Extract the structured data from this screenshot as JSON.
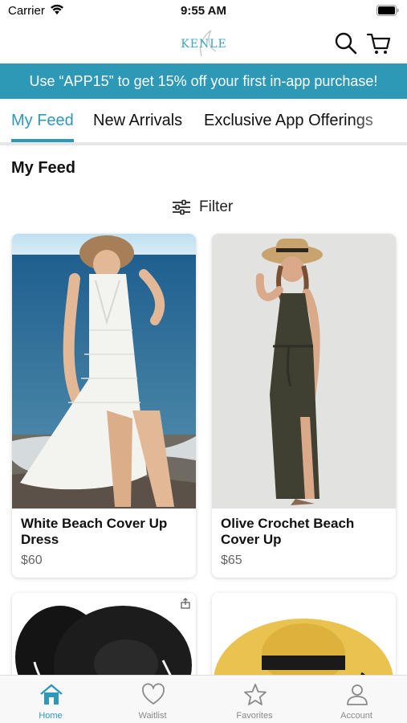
{
  "status_bar": {
    "carrier": "Carrier",
    "time": "9:55 AM"
  },
  "header": {
    "logo_text": "KENLE",
    "search_icon": "search-icon",
    "cart_icon": "cart-icon"
  },
  "promo": {
    "text": "Use “APP15” to get 15% off your first in-app purchase!"
  },
  "tabs": [
    {
      "label": "My Feed",
      "active": true
    },
    {
      "label": "New Arrivals",
      "active": false
    },
    {
      "label": "Exclusive App Offerings",
      "active": false
    }
  ],
  "feed": {
    "title": "My Feed",
    "filter_label": "Filter",
    "filter_icon": "sliders-icon"
  },
  "products": [
    {
      "name": "White Beach Cover Up Dress",
      "price": "$60"
    },
    {
      "name": "Olive Crochet Beach Cover Up",
      "price": "$65"
    },
    {
      "name": "",
      "price": ""
    },
    {
      "name": "",
      "price": ""
    }
  ],
  "tab_bar": {
    "items": [
      {
        "label": "Home",
        "icon": "home-icon",
        "active": true
      },
      {
        "label": "Waitlist",
        "icon": "heart-icon",
        "active": false
      },
      {
        "label": "Favorites",
        "icon": "star-icon",
        "active": false
      },
      {
        "label": "Account",
        "icon": "user-icon",
        "active": false
      }
    ]
  },
  "colors": {
    "accent": "#2e98b7",
    "banner_bg": "#2e98b7",
    "tab_bar_bg": "#f8f8f8"
  }
}
